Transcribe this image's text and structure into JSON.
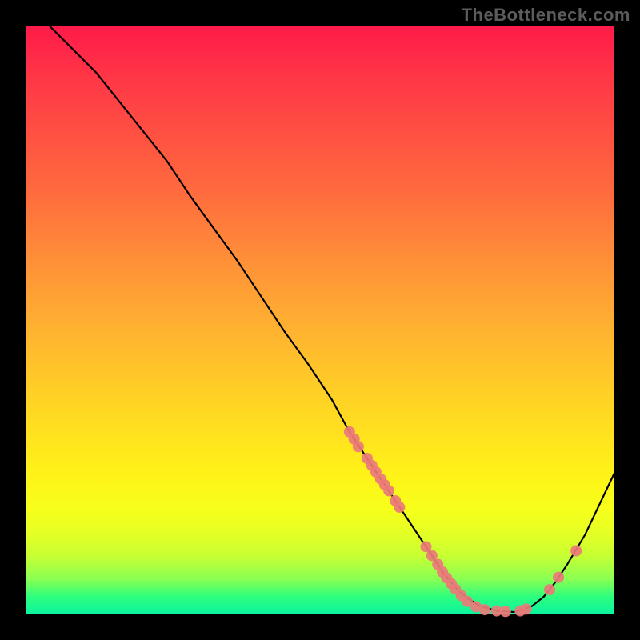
{
  "watermark": "TheBottleneck.com",
  "colors": {
    "dot_fill": "#ec7a7a",
    "curve_stroke": "#000000"
  },
  "chart_data": {
    "type": "line",
    "title": "",
    "xlabel": "",
    "ylabel": "",
    "xlim": [
      0,
      100
    ],
    "ylim": [
      0,
      100
    ],
    "grid": false,
    "series": [
      {
        "name": "bottleneck-curve",
        "x": [
          4,
          8,
          12,
          16,
          20,
          24,
          28,
          32,
          36,
          40,
          44,
          48,
          52,
          55,
          56,
          58,
          60,
          62,
          63,
          64,
          65,
          66,
          67,
          68,
          69,
          70,
          71,
          72,
          73,
          74,
          75,
          77,
          80,
          83,
          86,
          88,
          90,
          92,
          95,
          100
        ],
        "y": [
          100,
          96,
          92,
          87,
          82,
          77,
          71,
          65.5,
          60,
          54,
          48,
          42.5,
          36.5,
          31,
          29.5,
          26.5,
          23.5,
          20.5,
          19,
          17.5,
          16,
          14.5,
          13,
          11.5,
          10,
          8.5,
          7,
          5.8,
          4.6,
          3.6,
          2.8,
          1.5,
          0.6,
          0.4,
          1.4,
          3.0,
          5.5,
          8.5,
          13.5,
          24
        ]
      }
    ],
    "dots": [
      {
        "x": 55.0,
        "y": 31.0
      },
      {
        "x": 55.8,
        "y": 29.8
      },
      {
        "x": 56.5,
        "y": 28.5
      },
      {
        "x": 58.0,
        "y": 26.5
      },
      {
        "x": 58.8,
        "y": 25.3
      },
      {
        "x": 59.5,
        "y": 24.2
      },
      {
        "x": 60.3,
        "y": 23.0
      },
      {
        "x": 61.0,
        "y": 22.0
      },
      {
        "x": 61.7,
        "y": 21.0
      },
      {
        "x": 62.8,
        "y": 19.3
      },
      {
        "x": 63.5,
        "y": 18.2
      },
      {
        "x": 68.0,
        "y": 11.5
      },
      {
        "x": 69.0,
        "y": 10.0
      },
      {
        "x": 70.0,
        "y": 8.5
      },
      {
        "x": 70.8,
        "y": 7.2
      },
      {
        "x": 71.5,
        "y": 6.2
      },
      {
        "x": 72.3,
        "y": 5.2
      },
      {
        "x": 73.0,
        "y": 4.3
      },
      {
        "x": 74.0,
        "y": 3.2
      },
      {
        "x": 75.0,
        "y": 2.2
      },
      {
        "x": 76.5,
        "y": 1.3
      },
      {
        "x": 78.0,
        "y": 0.8
      },
      {
        "x": 80.0,
        "y": 0.6
      },
      {
        "x": 81.5,
        "y": 0.5
      },
      {
        "x": 84.0,
        "y": 0.6
      },
      {
        "x": 85.0,
        "y": 0.9
      },
      {
        "x": 89.0,
        "y": 4.2
      },
      {
        "x": 90.5,
        "y": 6.3
      },
      {
        "x": 93.5,
        "y": 10.8
      }
    ],
    "dot_radius": 7
  }
}
